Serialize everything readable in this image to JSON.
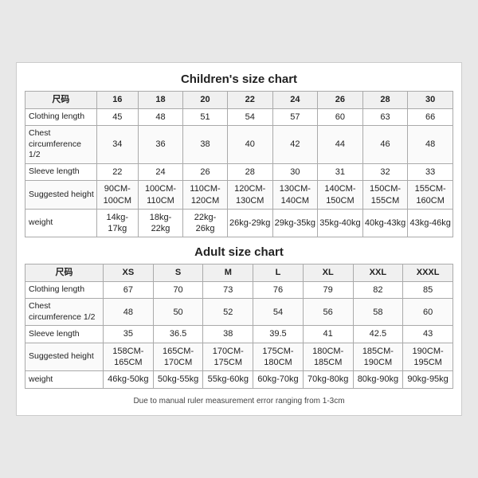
{
  "children_chart": {
    "title": "Children's size chart",
    "columns": [
      "尺码",
      "16",
      "18",
      "20",
      "22",
      "24",
      "26",
      "28",
      "30"
    ],
    "rows": [
      {
        "label": "Clothing length",
        "values": [
          "45",
          "48",
          "51",
          "54",
          "57",
          "60",
          "63",
          "66"
        ]
      },
      {
        "label": "Chest circumference 1/2",
        "values": [
          "34",
          "36",
          "38",
          "40",
          "42",
          "44",
          "46",
          "48"
        ]
      },
      {
        "label": "Sleeve length",
        "values": [
          "22",
          "24",
          "26",
          "28",
          "30",
          "31",
          "32",
          "33"
        ]
      },
      {
        "label": "Suggested height",
        "values": [
          "90CM-100CM",
          "100CM-110CM",
          "110CM-120CM",
          "120CM-130CM",
          "130CM-140CM",
          "140CM-150CM",
          "150CM-155CM",
          "155CM-160CM"
        ]
      },
      {
        "label": "weight",
        "values": [
          "14kg-17kg",
          "18kg-22kg",
          "22kg-26kg",
          "26kg-29kg",
          "29kg-35kg",
          "35kg-40kg",
          "40kg-43kg",
          "43kg-46kg"
        ]
      }
    ]
  },
  "adult_chart": {
    "title": "Adult size chart",
    "columns": [
      "尺码",
      "XS",
      "S",
      "M",
      "L",
      "XL",
      "XXL",
      "XXXL"
    ],
    "rows": [
      {
        "label": "Clothing length",
        "values": [
          "67",
          "70",
          "73",
          "76",
          "79",
          "82",
          "85"
        ]
      },
      {
        "label": "Chest circumference 1/2",
        "values": [
          "48",
          "50",
          "52",
          "54",
          "56",
          "58",
          "60"
        ]
      },
      {
        "label": "Sleeve length",
        "values": [
          "35",
          "36.5",
          "38",
          "39.5",
          "41",
          "42.5",
          "43"
        ]
      },
      {
        "label": "Suggested height",
        "values": [
          "158CM-165CM",
          "165CM-170CM",
          "170CM-175CM",
          "175CM-180CM",
          "180CM-185CM",
          "185CM-190CM",
          "190CM-195CM"
        ]
      },
      {
        "label": "weight",
        "values": [
          "46kg-50kg",
          "50kg-55kg",
          "55kg-60kg",
          "60kg-70kg",
          "70kg-80kg",
          "80kg-90kg",
          "90kg-95kg"
        ]
      }
    ]
  },
  "footnote": "Due to manual ruler measurement error ranging from 1-3cm"
}
